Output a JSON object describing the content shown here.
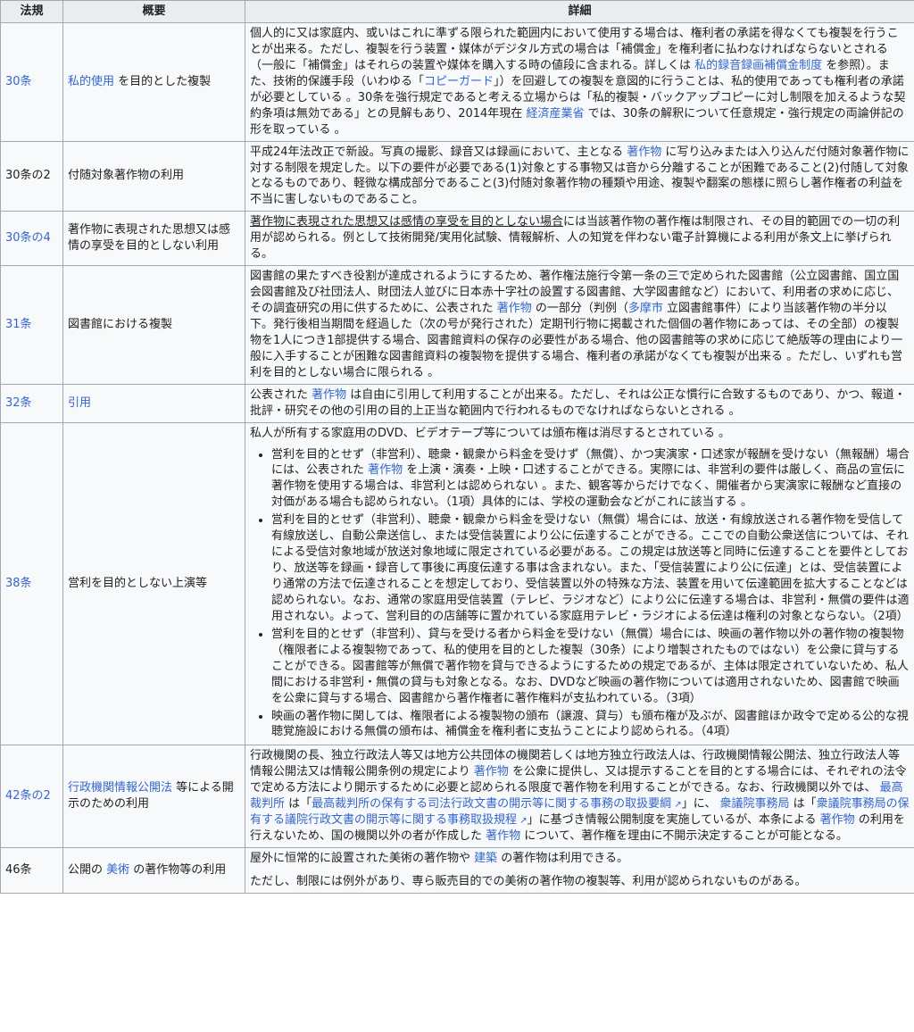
{
  "header": {
    "law": "法規",
    "summary": "概要",
    "detail": "詳細"
  },
  "rows": [
    {
      "law": "30条",
      "summary_link": "私的使用",
      "summary_rest": " を目的とした複製",
      "detail": [
        {
          "t": "個人的に又は家庭内、或いはこれに準ずる限られた範囲内において使用する場合は、権利者の承諾を得なくても複製を行うことが出来る。ただし、複製を行う装置・媒体がデジタル方式の場合は「補償金」を権利者に払わなければならないとされる（一般に「補償金」はそれらの装置や媒体を購入する時の値段に含まれる。詳しくは "
        },
        {
          "a": "私的録音録画補償金制度"
        },
        {
          "t": " を参照）。また、技術的保護手段（いわゆる「"
        },
        {
          "a": "コピーガード"
        },
        {
          "t": "」）を回避しての複製を意図的に行うことは、私的使用であっても権利者の承諾が必要としている 。30条を強行規定であると考える立場からは「私的複製・バックアップコピーに対し制限を加えるような契約条項は無効である」との見解もあり、2014年現在 "
        },
        {
          "a": "経済産業省"
        },
        {
          "t": " では、30条の解釈について任意規定・強行規定の両論併記の形を取っている 。"
        }
      ]
    },
    {
      "law": "30条の2",
      "summary": "付随対象著作物の利用",
      "detail": [
        {
          "t": "平成24年法改正で新設。写真の撮影、録音又は録画において、主となる "
        },
        {
          "a": "著作物"
        },
        {
          "t": " に写り込みまたは入り込んだ付随対象著作物に対する制限を規定した。以下の要件が必要である(1)対象とする事物又は音から分離することが困難であること(2)付随して対象となるものであり、軽微な構成部分であること(3)付随対象著作物の種類や用途、複製や翻案の態様に照らし著作権者の利益を不当に害しないものであること。"
        }
      ]
    },
    {
      "law": "30条の4",
      "summary": "著作物に表現された思想又は感情の享受を目的としない利用",
      "detail": [
        {
          "u": "著作物に表現された思想又は感情の享受を目的としない場合"
        },
        {
          "t": "には当該著作物の著作権は制限され、その目的範囲での一切の利用が認められる。例として技術開発/実用化試験、情報解析、人の知覚を伴わない電子計算機による利用が条文上に挙げられる。"
        }
      ]
    },
    {
      "law": "31条",
      "summary": "図書館における複製",
      "detail": [
        {
          "t": "図書館の果たすべき役割が達成されるようにするため、著作権法施行令第一条の三で定められた図書館（公立図書館、国立国会図書館及び社団法人、財団法人並びに日本赤十字社の設置する図書館、大学図書館など）において、利用者の求めに応じ、その調査研究の用に供するために、公表された "
        },
        {
          "a": "著作物"
        },
        {
          "t": " の一部分（判例（"
        },
        {
          "a": "多摩市"
        },
        {
          "t": " 立図書館事件）により当該著作物の半分以下。発行後相当期間を経過した（次の号が発行された）定期刊行物に掲載された個個の著作物にあっては、その全部）の複製物を1人につき1部提供する場合、図書館資料の保存の必要性がある場合、他の図書館等の求めに応じて絶版等の理由により一般に入手することが困難な図書館資料の複製物を提供する場合、権利者の承諾がなくても複製が出来る 。ただし、いずれも営利を目的としない場合に限られる 。"
        }
      ]
    },
    {
      "law": "32条",
      "summary_link": "引用",
      "summary_rest": "",
      "detail": [
        {
          "t": "公表された "
        },
        {
          "a": "著作物"
        },
        {
          "t": " は自由に引用して利用することが出来る。ただし、それは公正な慣行に合致するものであり、かつ、報道・批評・研究その他の引用の目的上正当な範囲内で行われるものでなければならないとされる 。"
        }
      ]
    },
    {
      "law": "38条",
      "summary": "営利を目的としない上演等",
      "intro": "私人が所有する家庭用のDVD、ビデオテープ等については頒布権は消尽するとされている 。",
      "bullets": [
        [
          {
            "t": "営利を目的とせず（非営利）、聴衆・観衆から料金を受けず（無償）、かつ実演家・口述家が報酬を受けない（無報酬）場合には、公表された "
          },
          {
            "a": "著作物"
          },
          {
            "t": " を上演・演奏・上映・口述することができる。実際には、非営利の要件は厳しく、商品の宣伝に著作物を使用する場合は、非営利とは認められない 。また、観客等からだけでなく、開催者から実演家に報酬など直接の対価がある場合も認められない。（1項）具体的には、学校の運動会などがこれに該当する 。"
          }
        ],
        [
          {
            "t": "営利を目的とせず（非営利）、聴衆・観衆から料金を受けない（無償）場合には、放送・有線放送される著作物を受信して有線放送し、自動公衆送信し、または受信装置により公に伝達することができる。ここでの自動公衆送信については、それによる受信対象地域が放送対象地域に限定されている必要がある。この規定は放送等と同時に伝達することを要件としており、放送等を録画・録音して事後に再度伝達する事は含まれない。また、「受信装置により公に伝達」とは、受信装置により通常の方法で伝達されることを想定しており、受信装置以外の特殊な方法、装置を用いて伝達範囲を拡大することなどは認められない。なお、通常の家庭用受信装置（テレビ、ラジオなど）により公に伝達する場合は、非営利・無償の要件は適用されない。よって、営利目的の店舗等に置かれている家庭用テレビ・ラジオによる伝達は権利の対象とならない。（2項）"
          }
        ],
        [
          {
            "t": "営利を目的とせず（非営利）、貸与を受ける者から料金を受けない（無償）場合には、映画の著作物以外の著作物の複製物（権限者による複製物であって、私的使用を目的とした複製（30条）により増製されたものではない）を公衆に貸与することができる。図書館等が無償で著作物を貸与できるようにするための規定であるが、主体は限定されていないため、私人間における非営利・無償の貸与も対象となる。なお、DVDなど映画の著作物については適用されないため、図書館で映画を公衆に貸与する場合、図書館から著作権者に著作権料が支払われている。（3項）"
          }
        ],
        [
          {
            "t": "映画の著作物に関しては、権限者による複製物の頒布（譲渡、貸与）も頒布権が及ぶが、図書館ほか政令で定める公的な視聴覚施設における無償の頒布は、補償金を権利者に支払うことにより認められる。（4項）"
          }
        ]
      ]
    },
    {
      "law": "42条の2",
      "summary_link": "行政機関情報公開法",
      "summary_rest": " 等による開示のための利用",
      "detail": [
        {
          "t": "行政機関の長、独立行政法人等又は地方公共団体の機関若しくは地方独立行政法人は、行政機関情報公開法、独立行政法人等情報公開法又は情報公開条例の規定により "
        },
        {
          "a": "著作物"
        },
        {
          "t": " を公衆に提供し、又は提示することを目的とする場合には、それぞれの法令で定める方法により開示するために必要と認められる限度で著作物を利用することができる。なお、行政機関以外では、 "
        },
        {
          "a": "最高裁判所"
        },
        {
          "t": " は「"
        },
        {
          "e": "最高裁判所の保有する司法行政文書の開示等に関する事務の取扱要綱"
        },
        {
          "t": "」に、 "
        },
        {
          "a": "衆議院事務局"
        },
        {
          "t": " は「"
        },
        {
          "e": "衆議院事務局の保有する議院行政文書の開示等に関する事務取扱規程"
        },
        {
          "t": "」に基づき情報公開制度を実施しているが、本条による "
        },
        {
          "a": "著作物"
        },
        {
          "t": " の利用を行えないため、国の機関以外の者が作成した "
        },
        {
          "a": "著作物"
        },
        {
          "t": " について、著作権を理由に不開示決定することが可能となる。"
        }
      ]
    },
    {
      "law": "46条",
      "summary_pre": "公開の ",
      "summary_link": "美術",
      "summary_rest": " の著作物等の利用",
      "paras": [
        [
          {
            "t": "屋外に恒常的に設置された美術の著作物や "
          },
          {
            "a": "建築"
          },
          {
            "t": " の著作物は利用できる。"
          }
        ],
        [
          {
            "t": "ただし、制限には例外があり、専ら販売目的での美術の著作物の複製等、利用が認められないものがある。"
          }
        ]
      ]
    }
  ]
}
